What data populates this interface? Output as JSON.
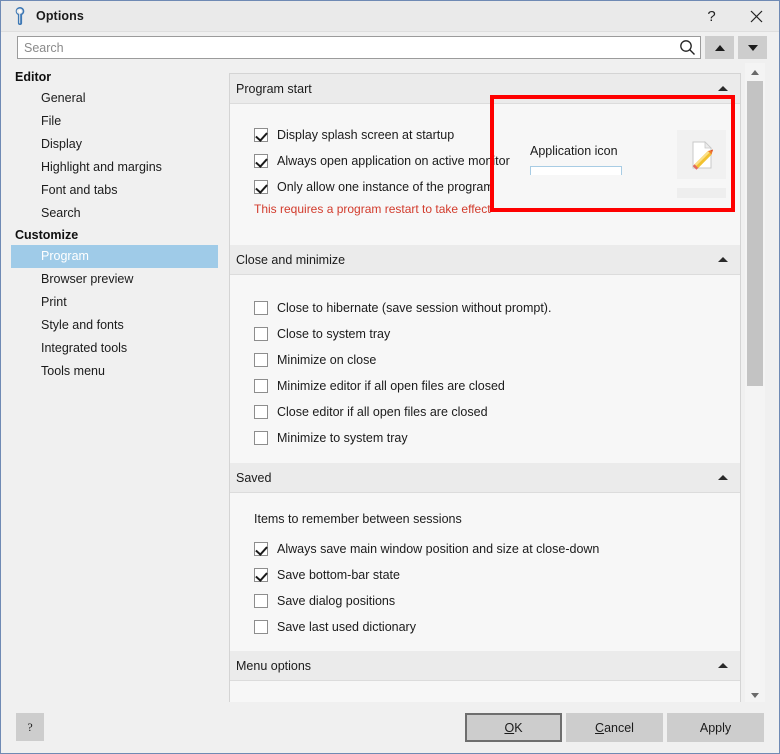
{
  "window": {
    "title": "Options",
    "icon": "wrench-icon",
    "help_label": "?",
    "close_label": "✕"
  },
  "search": {
    "placeholder": "Search",
    "value": "",
    "icon": "search-icon",
    "prev_label": "▲",
    "next_label": "▼"
  },
  "sidebar": {
    "groups": [
      {
        "label": "Editor",
        "items": [
          {
            "label": "General",
            "selected": false
          },
          {
            "label": "File",
            "selected": false
          },
          {
            "label": "Display",
            "selected": false
          },
          {
            "label": "Highlight and margins",
            "selected": false
          },
          {
            "label": "Font and tabs",
            "selected": false
          },
          {
            "label": "Search",
            "selected": false
          }
        ]
      },
      {
        "label": "Customize",
        "items": [
          {
            "label": "Program",
            "selected": true
          },
          {
            "label": "Browser preview",
            "selected": false
          },
          {
            "label": "Print",
            "selected": false
          },
          {
            "label": "Style and fonts",
            "selected": false
          },
          {
            "label": "Integrated tools",
            "selected": false
          },
          {
            "label": "Tools menu",
            "selected": false
          }
        ]
      }
    ]
  },
  "sections": {
    "program_start": {
      "title": "Program start",
      "collapse_icon": "chevron-up-icon",
      "checkboxes": [
        {
          "label": "Display splash screen at startup",
          "checked": true
        },
        {
          "label": "Always open application on active monitor",
          "checked": true
        },
        {
          "label": "Only allow one instance of the program",
          "checked": true
        }
      ],
      "warning": "This requires a program restart to take effect",
      "application_icon": {
        "label": "Application icon",
        "preview_icon": "document-pencil-icon",
        "combo_value": ""
      }
    },
    "close_and_minimize": {
      "title": "Close and minimize",
      "collapse_icon": "chevron-up-icon",
      "checkboxes": [
        {
          "label": "Close to hibernate (save session without prompt).",
          "checked": false
        },
        {
          "label": "Close to system tray",
          "checked": false
        },
        {
          "label": "Minimize on close",
          "checked": false
        },
        {
          "label": "Minimize editor if all open files are closed",
          "checked": false
        },
        {
          "label": "Close editor if all open files are closed",
          "checked": false
        },
        {
          "label": "Minimize to system tray",
          "checked": false
        }
      ]
    },
    "saved": {
      "title": "Saved",
      "collapse_icon": "chevron-up-icon",
      "intro": "Items to remember between sessions",
      "checkboxes": [
        {
          "label": "Always save main window position and size at close-down",
          "checked": true
        },
        {
          "label": "Save bottom-bar state",
          "checked": true
        },
        {
          "label": "Save dialog positions",
          "checked": false
        },
        {
          "label": "Save last used dictionary",
          "checked": false
        }
      ]
    },
    "menu_options": {
      "title": "Menu options",
      "collapse_icon": "chevron-up-icon"
    }
  },
  "scrollbar": {
    "up_icon": "scroll-up-icon",
    "down_icon": "scroll-down-icon"
  },
  "footer": {
    "help_label": "?",
    "ok_label_pre": "O",
    "ok_label_post": "K",
    "cancel_label_pre": "C",
    "cancel_label_post": "ancel",
    "apply_label": "Apply"
  },
  "colors": {
    "selection": "#9fcbe8",
    "warning_text": "#d23b2c",
    "highlight_box": "#fe0000",
    "window_border": "#6f8ab4",
    "button_face": "#cdcdcd"
  }
}
